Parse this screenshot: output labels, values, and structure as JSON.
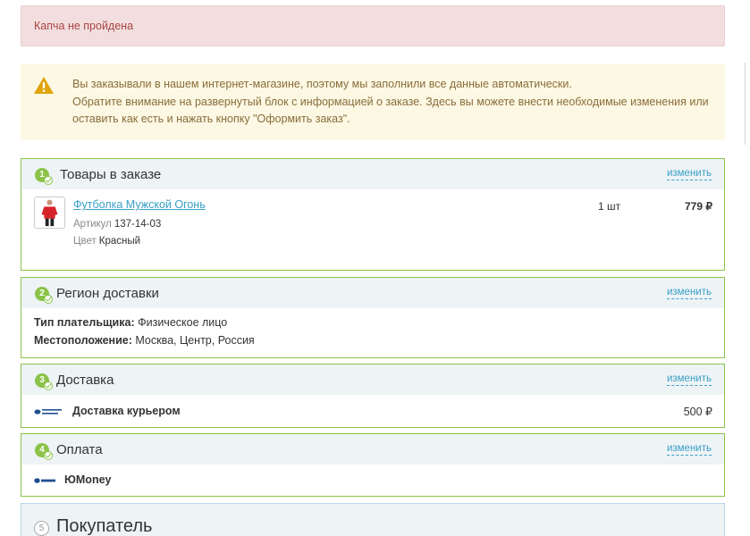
{
  "error_alert": {
    "text": "Капча не пройдена"
  },
  "info_alert": {
    "icon": "warning-icon",
    "lines": [
      "Вы заказывали в нашем интернет-магазине, поэтому мы заполнили все данные автоматически.",
      "Обратите внимание на развернутый блок с информацией о заказе. Здесь вы можете внести необходимые изменения или оставить как есть и нажать кнопку \"Оформить заказ\"."
    ]
  },
  "blocks": {
    "goods": {
      "step": "1",
      "title": "Товары в заказе",
      "change": "изменить",
      "item": {
        "name": "Футболка Мужской Огонь",
        "article_label": "Артикул",
        "article_value": "137-14-03",
        "color_label": "Цвет",
        "color_value": "Красный",
        "qty": "1 шт",
        "price": "779 ₽"
      }
    },
    "region": {
      "step": "2",
      "title": "Регион доставки",
      "change": "изменить",
      "payer_label": "Тип плательщика:",
      "payer_value": "Физическое лицо",
      "location_label": "Местоположение:",
      "location_value": "Москва, Центр, Россия"
    },
    "delivery": {
      "step": "3",
      "title": "Доставка",
      "change": "изменить",
      "name": "Доставка курьером",
      "price": "500 ₽"
    },
    "payment": {
      "step": "4",
      "title": "Оплата",
      "change": "изменить",
      "name": "ЮMoney"
    },
    "buyer": {
      "step": "5",
      "title": "Покупатель"
    }
  },
  "colors": {
    "accent_green": "#8bc34a",
    "link_blue": "#39a0c6",
    "error_bg": "#f2dede",
    "warn_bg": "#fcf8e3"
  }
}
